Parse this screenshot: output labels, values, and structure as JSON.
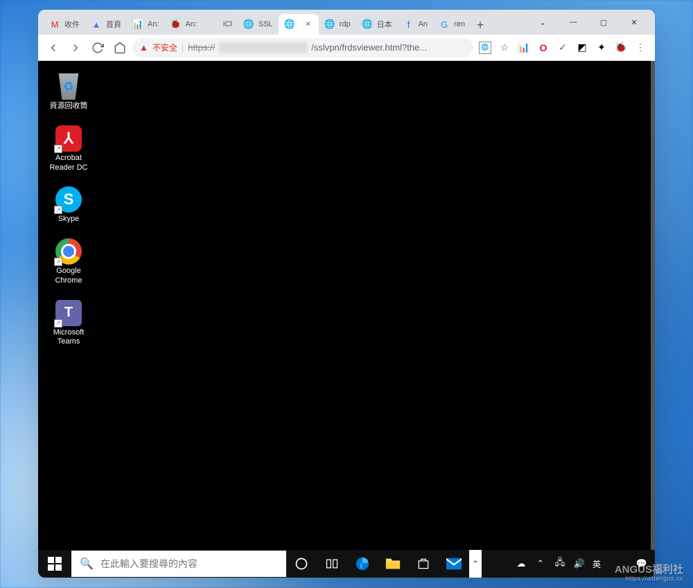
{
  "tabs": [
    {
      "title": "收件",
      "icon": "M",
      "icon_color": "#d93025"
    },
    {
      "title": "首頁",
      "icon": "▲",
      "icon_color": "#4285f4"
    },
    {
      "title": "An:",
      "icon": "📊",
      "icon_color": "#f4b400"
    },
    {
      "title": "An:",
      "icon": "🐞",
      "icon_color": "#d9534f"
    },
    {
      "title": "iCl",
      "icon": "",
      "icon_color": "#999"
    },
    {
      "title": "SSL",
      "icon": "🌐",
      "icon_color": "#5f6368"
    },
    {
      "title": "",
      "icon": "🌐",
      "icon_color": "#5f6368",
      "active": true
    },
    {
      "title": "rdp",
      "icon": "🌐",
      "icon_color": "#5f6368"
    },
    {
      "title": "日本",
      "icon": "🌐",
      "icon_color": "#5f6368"
    },
    {
      "title": "An",
      "icon": "f",
      "icon_color": "#1877f2"
    },
    {
      "title": "ren",
      "icon": "G",
      "icon_color": "#4285f4"
    }
  ],
  "address": {
    "unsafe_label": "不安全",
    "url_scheme": "https://",
    "url_blurred": "5█████████████",
    "url_path": "/sslvpn/frdsviewer.html?the..."
  },
  "extensions": {
    "translate": "🌐",
    "star": "☆",
    "chart": "📊",
    "opera": "O",
    "check": "✓",
    "dark": "◩",
    "puzzle": "✦",
    "bug": "🐞",
    "menu": "⋮"
  },
  "desktop_icons": [
    {
      "label": "資源回收筒",
      "type": "recycle",
      "shortcut": false
    },
    {
      "label": "Acrobat\nReader DC",
      "type": "acrobat",
      "shortcut": true
    },
    {
      "label": "Skype",
      "type": "skype",
      "shortcut": true
    },
    {
      "label": "Google\nChrome",
      "type": "chrome",
      "shortcut": true
    },
    {
      "label": "Microsoft\nTeams",
      "type": "teams",
      "shortcut": true
    }
  ],
  "taskbar": {
    "search_placeholder": "在此輸入要搜尋的內容",
    "lang": "英"
  },
  "watermark": {
    "main": "ANGUS福利社",
    "sub": "https://wuangus.cc"
  }
}
